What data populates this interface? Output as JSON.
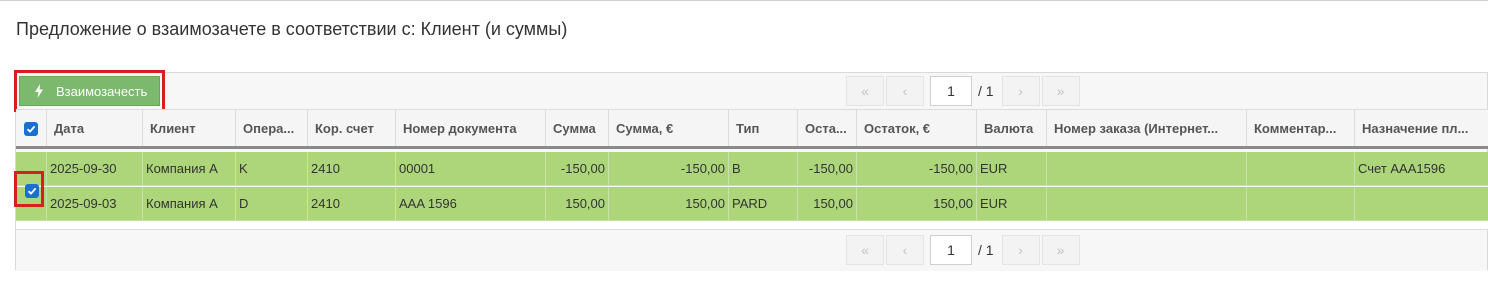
{
  "page": {
    "title": "Предложение о взаимозачете в соответствии с: Клиент (и суммы)"
  },
  "toolbar": {
    "offset_label": "Взаимозачесть",
    "offset_icon": "bolt-icon"
  },
  "pager": {
    "first": "«",
    "prev": "‹",
    "next": "›",
    "last": "»",
    "current_page": "1",
    "total": "/ 1"
  },
  "table": {
    "columns": [
      {
        "key": "date",
        "label": "Дата"
      },
      {
        "key": "client",
        "label": "Клиент"
      },
      {
        "key": "operation",
        "label": "Опера..."
      },
      {
        "key": "account",
        "label": "Кор. счет"
      },
      {
        "key": "doc_no",
        "label": "Номер документа"
      },
      {
        "key": "sum",
        "label": "Сумма"
      },
      {
        "key": "sum_eur",
        "label": "Сумма, €"
      },
      {
        "key": "type",
        "label": "Тип"
      },
      {
        "key": "rest",
        "label": "Оста..."
      },
      {
        "key": "rest_eur",
        "label": "Остаток, €"
      },
      {
        "key": "currency",
        "label": "Валюта"
      },
      {
        "key": "order_no",
        "label": "Номер заказа (Интернет..."
      },
      {
        "key": "comment",
        "label": "Комментар..."
      },
      {
        "key": "purpose",
        "label": "Назначение пл..."
      }
    ],
    "rows": [
      {
        "selected": true,
        "date": "2025-09-30",
        "client": "Компания А",
        "operation": "K",
        "account": "2410",
        "doc_no": "00001",
        "sum": "-150,00",
        "sum_eur": "-150,00",
        "type": "B",
        "rest": "-150,00",
        "rest_eur": "-150,00",
        "currency": "EUR",
        "order_no": "",
        "comment": "",
        "purpose": "Счет AAA1596"
      },
      {
        "selected": true,
        "date": "2025-09-03",
        "client": "Компания А",
        "operation": "D",
        "account": "2410",
        "doc_no": "AAA 1596",
        "sum": "150,00",
        "sum_eur": "150,00",
        "type": "PARD",
        "rest": "150,00",
        "rest_eur": "150,00",
        "currency": "EUR",
        "order_no": "",
        "comment": "",
        "purpose": ""
      }
    ]
  },
  "colors": {
    "row_selected": "#add67a",
    "button": "#7cb86d",
    "highlight": "#d91e1e",
    "checkbox": "#1b6fd1"
  }
}
